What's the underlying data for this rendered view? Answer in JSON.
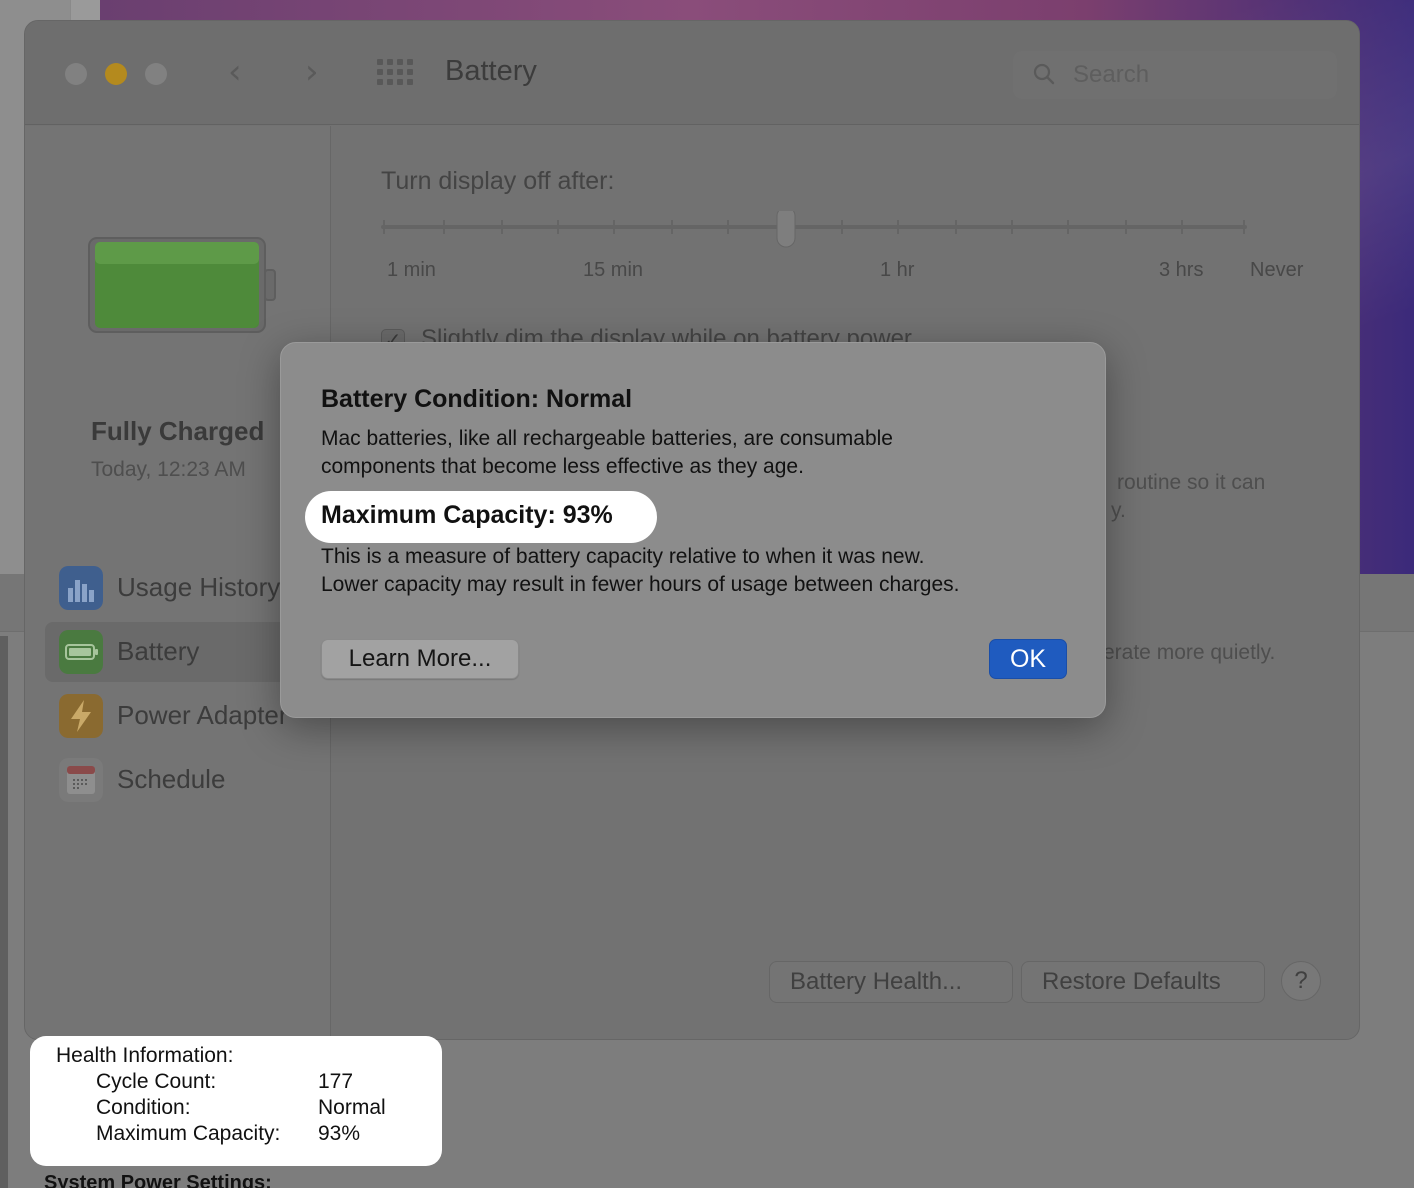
{
  "window": {
    "title": "Battery",
    "search_placeholder": "Search"
  },
  "sidebar": {
    "status": "Fully Charged",
    "status_time": "Today, 12:23 AM",
    "items": [
      {
        "label": "Usage History",
        "icon": "bar-chart-icon"
      },
      {
        "label": "Battery",
        "icon": "battery-icon",
        "selected": true
      },
      {
        "label": "Power Adapter",
        "icon": "lightning-icon"
      },
      {
        "label": "Schedule",
        "icon": "calendar-icon"
      }
    ]
  },
  "main": {
    "turn_off_label": "Turn display off after:",
    "slider_ticks": [
      "1 min",
      "15 min",
      "1 hr",
      "3 hrs",
      "Never"
    ],
    "dim_label": "Slightly dim the display while on battery power",
    "dim_checked": true,
    "behind_text_1": "routine so it can",
    "behind_text_2": "y.",
    "behind_text_3": "erate more quietly.",
    "battery_health_button": "Battery Health...",
    "restore_defaults_button": "Restore Defaults",
    "help_button": "?"
  },
  "sheet": {
    "title": "Battery Condition: Normal",
    "intro_line1": "Mac batteries, like all rechargeable batteries, are consumable",
    "intro_line2": "components that become less effective as they age.",
    "capacity": "Maximum Capacity: 93%",
    "desc_line1": "This is a measure of battery capacity relative to when it was new.",
    "desc_line2": "Lower capacity may result in fewer hours of usage between charges.",
    "learn_more": "Learn More...",
    "ok": "OK"
  },
  "health_info": {
    "title": "Health Information:",
    "rows": [
      {
        "label": "Cycle Count:",
        "value": "177"
      },
      {
        "label": "Condition:",
        "value": "Normal"
      },
      {
        "label": "Maximum Capacity:",
        "value": "93%"
      }
    ]
  },
  "system_power_settings": "System Power Settings:",
  "colors": {
    "ok_button": "#1f5bbf",
    "battery_fill": "#4e8a3a",
    "minimize": "#b48a1e"
  }
}
